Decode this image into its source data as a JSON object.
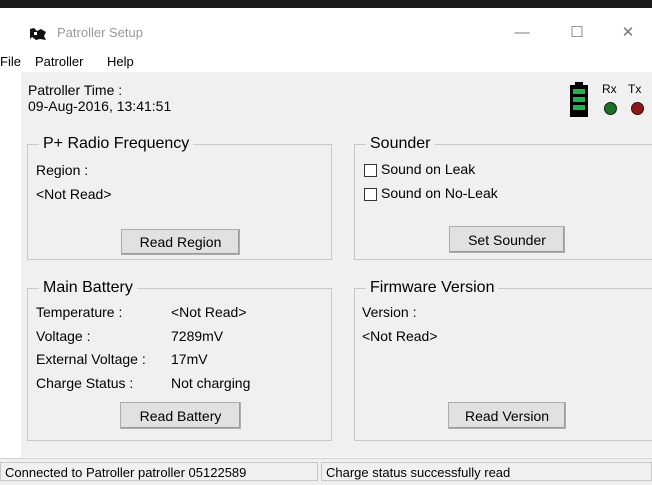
{
  "window": {
    "title": "Patroller Setup",
    "minimize_icon": "minimize-icon",
    "maximize_icon": "maximize-icon",
    "close_icon": "close-icon"
  },
  "menu": [
    "File",
    "Patroller",
    "Help"
  ],
  "header": {
    "time_label": "Patroller Time :",
    "time_value": "09-Aug-2016, 13:41:51",
    "battery_icon": "battery-icon",
    "rx_label": "Rx",
    "tx_label": "Tx",
    "rx_color": "#1f6e2a",
    "tx_color": "#8a1a1a",
    "battery_color": "#22b14c"
  },
  "radio": {
    "title": "P+ Radio Frequency",
    "region_label": "Region :",
    "region_value": "<Not Read>",
    "button": "Read Region"
  },
  "sounder": {
    "title": "Sounder",
    "options": [
      {
        "label": "Sound on Leak",
        "checked": false
      },
      {
        "label": "Sound on No-Leak",
        "checked": false
      }
    ],
    "button": "Set Sounder"
  },
  "battery": {
    "title": "Main Battery",
    "rows": [
      {
        "label": "Temperature :",
        "value": "<Not Read>"
      },
      {
        "label": "Voltage :",
        "value": "7289mV"
      },
      {
        "label": "External Voltage :",
        "value": "17mV"
      },
      {
        "label": "Charge Status :",
        "value": "Not charging"
      }
    ],
    "button": "Read Battery"
  },
  "firmware": {
    "title": "Firmware Version",
    "version_label": "Version :",
    "version_value": "<Not Read>",
    "button": "Read Version"
  },
  "status": {
    "left": "Connected to Patroller patroller 05122589",
    "right": "Charge status successfully read"
  }
}
